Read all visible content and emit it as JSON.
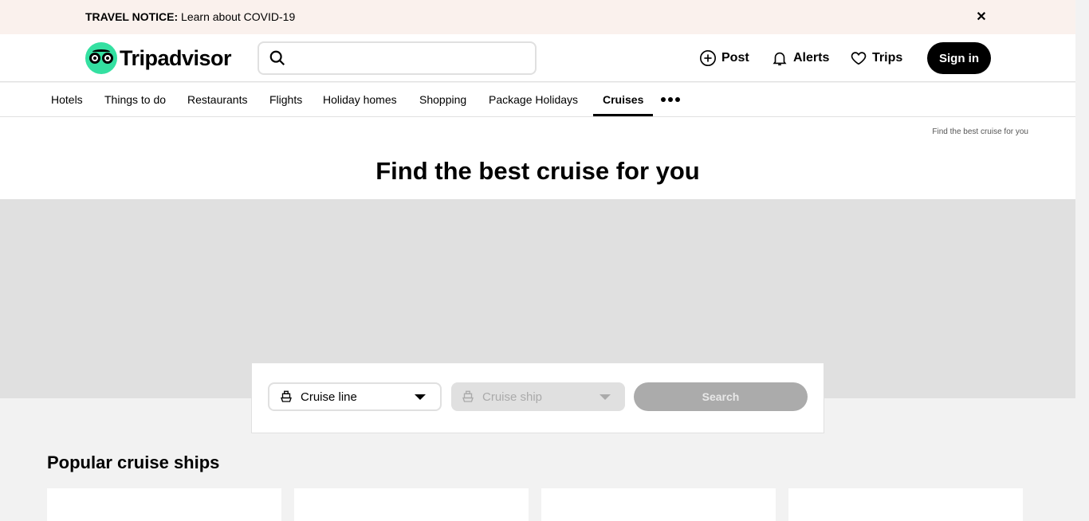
{
  "notice": {
    "label": "TRAVEL NOTICE:",
    "text": "Learn about COVID-19",
    "close_glyph": "✕"
  },
  "header": {
    "logo_text": "Tripadvisor",
    "search_placeholder": "",
    "post_label": "Post",
    "alerts_label": "Alerts",
    "trips_label": "Trips",
    "signin_label": "Sign in"
  },
  "nav": {
    "items": [
      {
        "label": "Hotels"
      },
      {
        "label": "Things to do"
      },
      {
        "label": "Restaurants"
      },
      {
        "label": "Flights"
      },
      {
        "label": "Holiday homes"
      },
      {
        "label": "Shopping"
      },
      {
        "label": "Package Holidays"
      },
      {
        "label": "Cruises",
        "active": true
      }
    ]
  },
  "hero": {
    "breadcrumb": "Find the best cruise for you",
    "title": "Find the best cruise for you"
  },
  "cruise_search": {
    "line_label": "Cruise line",
    "ship_label": "Cruise ship",
    "search_label": "Search"
  },
  "popular": {
    "title": "Popular cruise ships"
  },
  "colors": {
    "brand_green": "#34e0a1",
    "notice_bg": "#faf1ed"
  }
}
